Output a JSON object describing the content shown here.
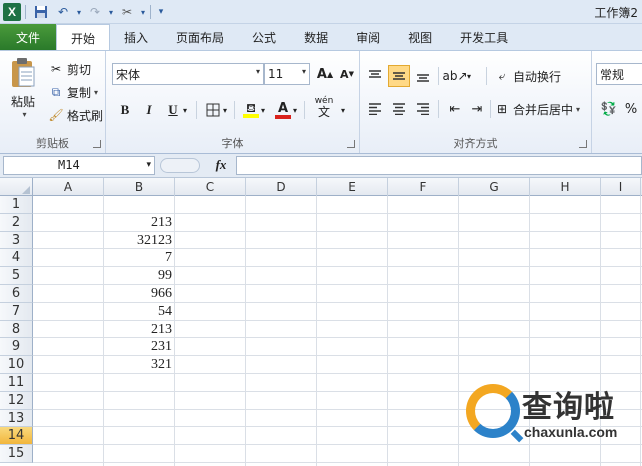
{
  "titlebar": {
    "app_logo": "X",
    "title": "工作簿2",
    "qat": {
      "save_icon": "save-icon",
      "undo_icon": "undo-icon",
      "redo_icon": "redo-icon",
      "tools_icon": "tools-icon"
    }
  },
  "tabs": {
    "file": "文件",
    "items": [
      "开始",
      "插入",
      "页面布局",
      "公式",
      "数据",
      "审阅",
      "视图",
      "开发工具"
    ],
    "active": "开始"
  },
  "ribbon": {
    "clipboard": {
      "label": "剪贴板",
      "paste": "粘贴",
      "cut": "剪切",
      "copy": "复制",
      "format_painter": "格式刷"
    },
    "font": {
      "label": "字体",
      "font_name": "宋体",
      "font_size": "11",
      "bold": "B",
      "italic": "I",
      "underline": "U",
      "grow": "A",
      "shrink": "A",
      "font_color_letter": "A",
      "wen": "wén"
    },
    "alignment": {
      "label": "对齐方式",
      "wrap_text": "自动换行",
      "merge_center": "合并后居中"
    },
    "number": {
      "format": "常规",
      "percent": "%"
    }
  },
  "formula_bar": {
    "name_box": "M14",
    "fx": "fx",
    "content": ""
  },
  "sheet": {
    "columns": [
      "A",
      "B",
      "C",
      "D",
      "E",
      "F",
      "G",
      "H",
      "I"
    ],
    "rows": [
      "1",
      "2",
      "3",
      "4",
      "5",
      "6",
      "7",
      "8",
      "9",
      "10",
      "11",
      "12",
      "13",
      "14",
      "15"
    ],
    "active_row": "14",
    "column_b_values": [
      "",
      "213",
      "32123",
      "7",
      "99",
      "966",
      "54",
      "213",
      "231",
      "321",
      "",
      "",
      "",
      "",
      ""
    ]
  },
  "watermark": {
    "text": "查询啦",
    "url": "chaxunla.com"
  },
  "colors": {
    "file_tab": "#2a7a2a",
    "ribbon_bg": "#dfe9f5",
    "active_row_header": "#f2b63c",
    "watermark_orange": "#f3a721",
    "watermark_blue": "#2c82c9"
  }
}
